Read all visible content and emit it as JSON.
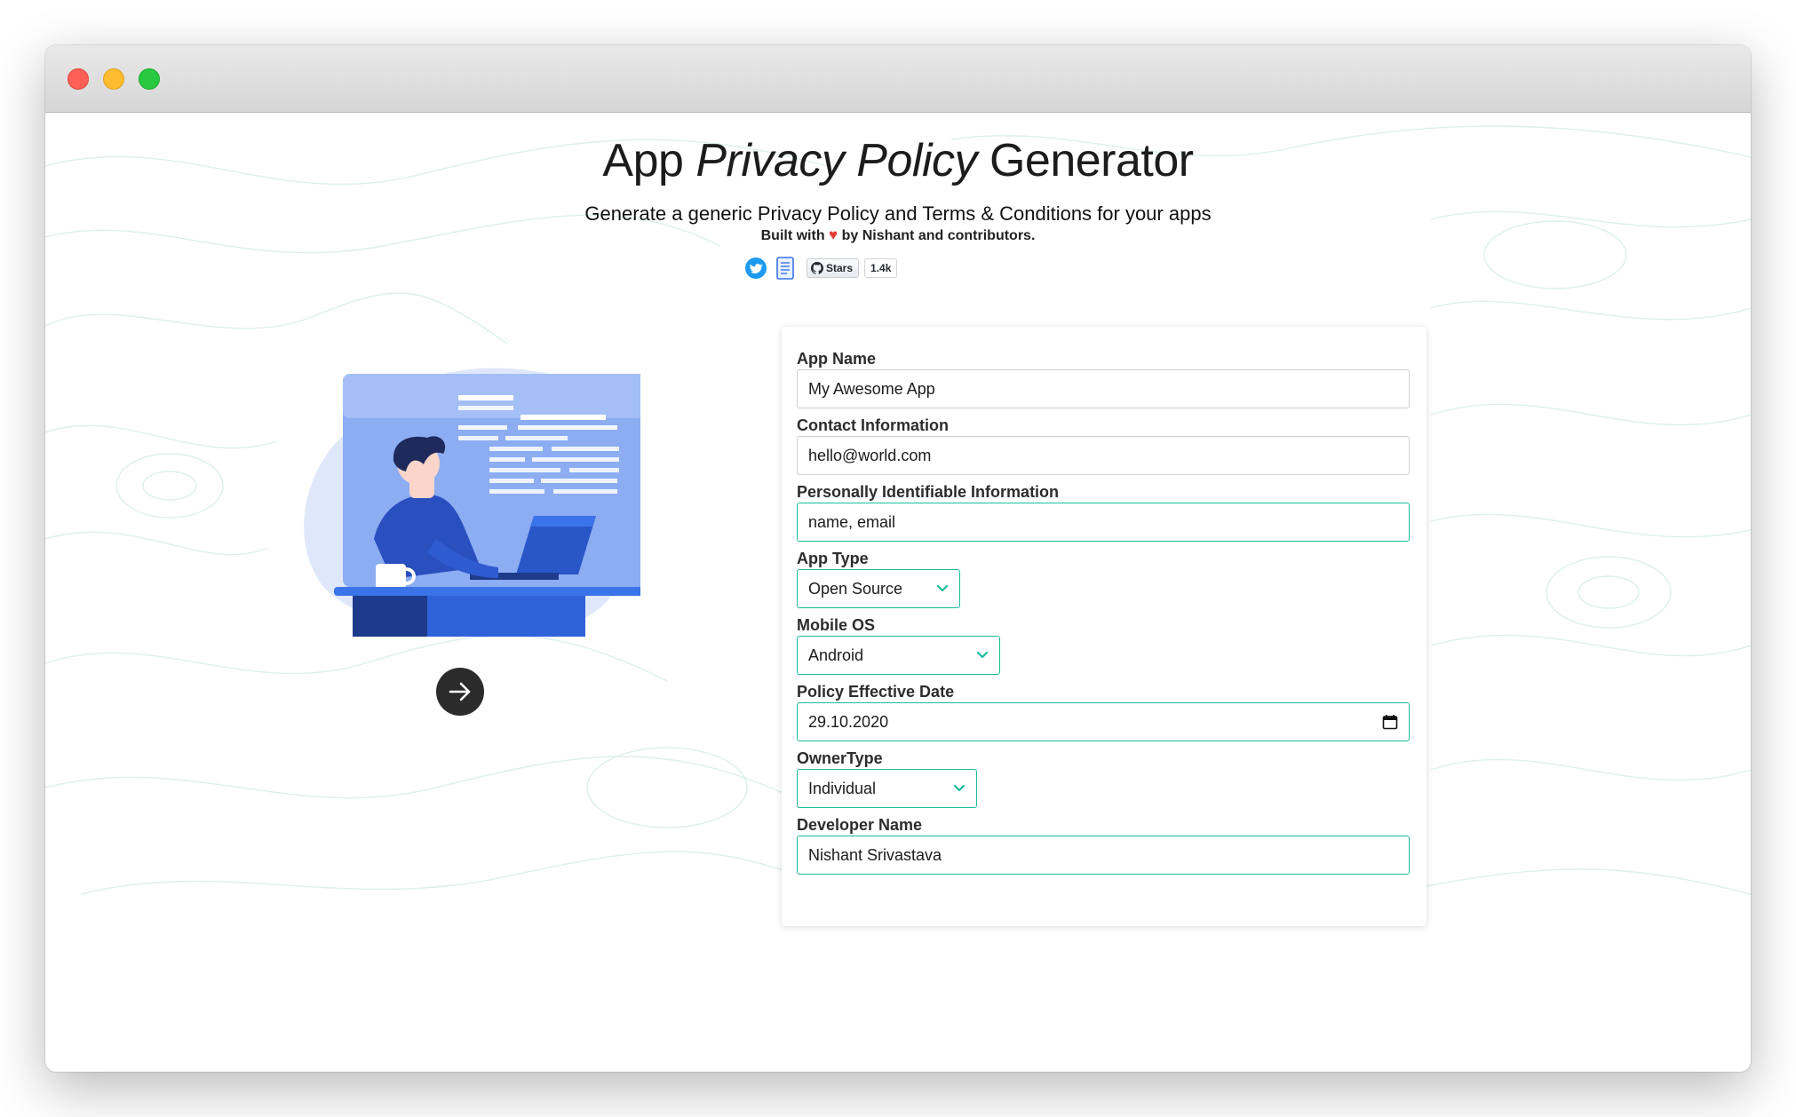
{
  "window": {
    "controls": [
      "close",
      "minimize",
      "zoom"
    ]
  },
  "header": {
    "title_part1": "App ",
    "title_italic": "Privacy Policy",
    "title_part2": " Generator",
    "subtitle": "Generate a generic Privacy Policy and Terms & Conditions for your apps",
    "byline_prefix": "Built with",
    "byline_suffix": "by Nishant and contributors."
  },
  "social": {
    "icons": [
      "twitter-icon",
      "document-icon",
      "github-icon"
    ],
    "github_label": "Stars",
    "github_count": "1.4k"
  },
  "next_button": {
    "icon": "arrow-right-icon"
  },
  "form": {
    "app_name": {
      "label": "App Name",
      "value": "My Awesome App"
    },
    "contact": {
      "label": "Contact Information",
      "value": "hello@world.com"
    },
    "pii": {
      "label": "Personally Identifiable Information",
      "value": "name, email"
    },
    "app_type": {
      "label": "App Type",
      "value": "Open Source"
    },
    "mobile_os": {
      "label": "Mobile OS",
      "value": "Android"
    },
    "effective_date": {
      "label": "Policy Effective Date",
      "value": "29.10.2020"
    },
    "owner_type": {
      "label": "OwnerType",
      "value": "Individual"
    },
    "developer_name": {
      "label": "Developer Name",
      "value": "Nishant Srivastava"
    }
  },
  "colors": {
    "accent": "#1abc9c",
    "illustration_blue": "#8cadf2",
    "illustration_dark": "#1e3a8a",
    "title_text": "#1c1c1c"
  }
}
